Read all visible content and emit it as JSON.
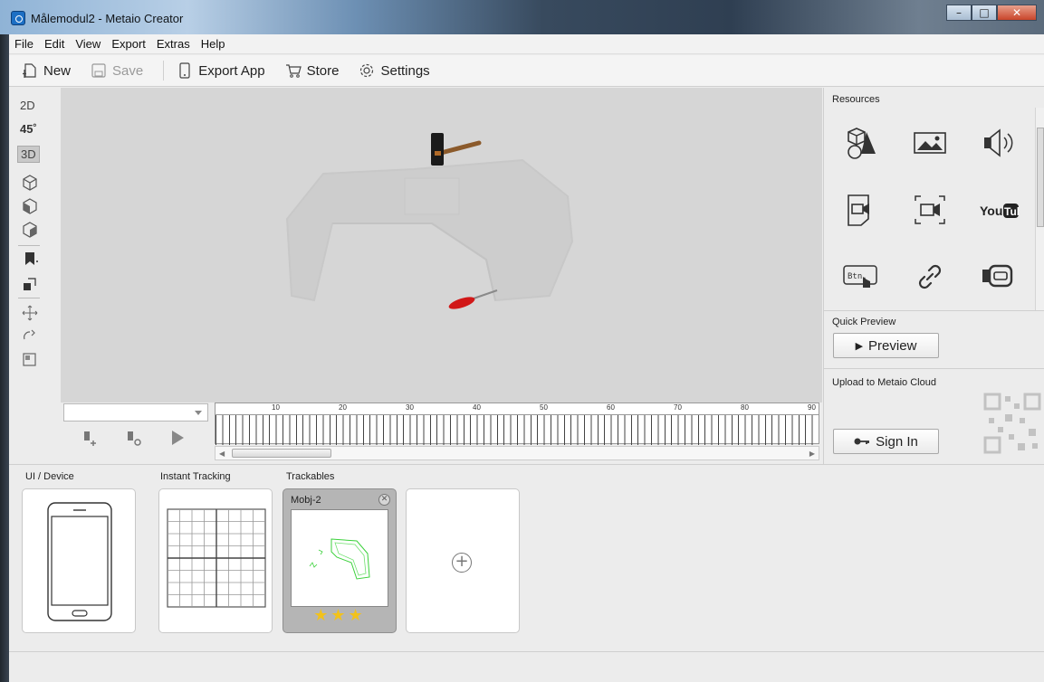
{
  "window": {
    "title": "Målemodul2 - Metaio Creator"
  },
  "menu": [
    "File",
    "Edit",
    "View",
    "Export",
    "Extras",
    "Help"
  ],
  "toolbar": {
    "new_label": "New",
    "save_label": "Save",
    "export_label": "Export App",
    "store_label": "Store",
    "settings_label": "Settings"
  },
  "view_modes": {
    "mode_2d": "2D",
    "mode_45": "45˚",
    "mode_3d": "3D",
    "active": "3D"
  },
  "timeline": {
    "ruler_labels": [
      "10",
      "20",
      "30",
      "40",
      "50",
      "60",
      "70",
      "80",
      "90"
    ]
  },
  "resources": {
    "label": "Resources",
    "items": [
      "3d-model",
      "image",
      "audio",
      "video",
      "camera-video",
      "YouTube",
      "button",
      "link",
      "social"
    ]
  },
  "quick_preview": {
    "label": "Quick Preview",
    "button": "Preview"
  },
  "cloud": {
    "label": "Upload to Metaio Cloud",
    "button": "Sign In"
  },
  "bottom": {
    "ui_device_label": "UI / Device",
    "instant_tracking_label": "Instant Tracking",
    "trackables_label": "Trackables",
    "trackable_name": "Mobj-2",
    "trackable_stars": "★★★"
  }
}
